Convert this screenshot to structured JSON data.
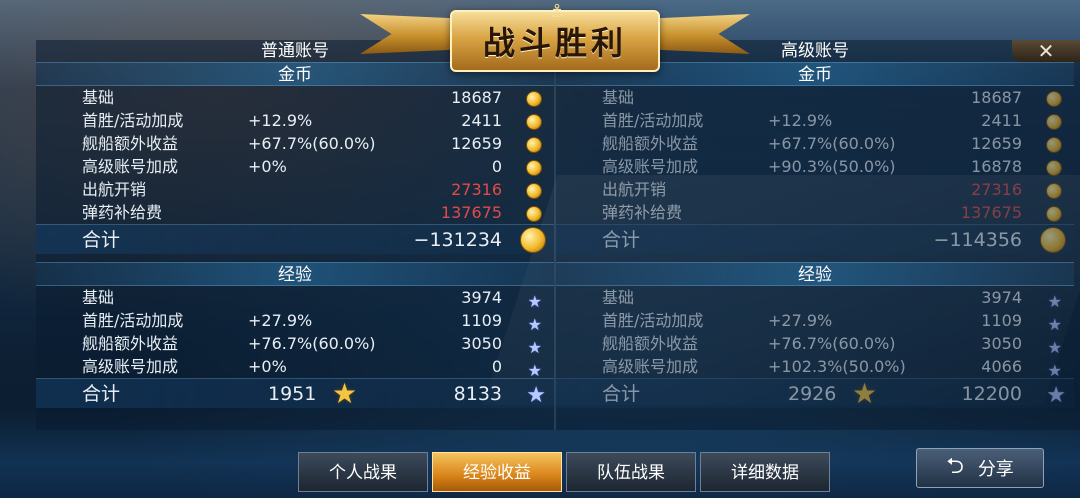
{
  "banner": {
    "title": "战斗胜利"
  },
  "close_label": "✕",
  "left": {
    "account_label": "普通账号",
    "gold": {
      "header": "金币",
      "rows": [
        {
          "label": "基础",
          "pct": "",
          "value": "18687",
          "red": false
        },
        {
          "label": "首胜/活动加成",
          "pct": "+12.9%",
          "value": "2411",
          "red": false
        },
        {
          "label": "舰船额外收益",
          "pct": "+67.7%(60.0%)",
          "value": "12659",
          "red": false
        },
        {
          "label": "高级账号加成",
          "pct": "+0%",
          "value": "0",
          "red": false
        },
        {
          "label": "出航开销",
          "pct": "",
          "value": "27316",
          "red": true
        },
        {
          "label": "弹药补给费",
          "pct": "",
          "value": "137675",
          "red": true
        }
      ],
      "total_label": "合计",
      "total_value": "−131234"
    },
    "exp": {
      "header": "经验",
      "rows": [
        {
          "label": "基础",
          "pct": "",
          "value": "3974"
        },
        {
          "label": "首胜/活动加成",
          "pct": "+27.9%",
          "value": "1109"
        },
        {
          "label": "舰船额外收益",
          "pct": "+76.7%(60.0%)",
          "value": "3050"
        },
        {
          "label": "高级账号加成",
          "pct": "+0%",
          "value": "0"
        }
      ],
      "total_label": "合计",
      "total_mid": "1951",
      "total_value": "8133"
    }
  },
  "right": {
    "account_label": "高级账号",
    "gold": {
      "header": "金币",
      "rows": [
        {
          "label": "基础",
          "pct": "",
          "value": "18687",
          "red": false
        },
        {
          "label": "首胜/活动加成",
          "pct": "+12.9%",
          "value": "2411",
          "red": false
        },
        {
          "label": "舰船额外收益",
          "pct": "+67.7%(60.0%)",
          "value": "12659",
          "red": false
        },
        {
          "label": "高级账号加成",
          "pct": "+90.3%(50.0%)",
          "value": "16878",
          "red": false
        },
        {
          "label": "出航开销",
          "pct": "",
          "value": "27316",
          "red": true
        },
        {
          "label": "弹药补给费",
          "pct": "",
          "value": "137675",
          "red": true
        }
      ],
      "total_label": "合计",
      "total_value": "−114356"
    },
    "exp": {
      "header": "经验",
      "rows": [
        {
          "label": "基础",
          "pct": "",
          "value": "3974"
        },
        {
          "label": "首胜/活动加成",
          "pct": "+27.9%",
          "value": "1109"
        },
        {
          "label": "舰船额外收益",
          "pct": "+76.7%(60.0%)",
          "value": "3050"
        },
        {
          "label": "高级账号加成",
          "pct": "+102.3%(50.0%)",
          "value": "4066"
        }
      ],
      "total_label": "合计",
      "total_mid": "2926",
      "total_value": "12200"
    }
  },
  "tabs": [
    {
      "label": "个人战果",
      "active": false
    },
    {
      "label": "经验收益",
      "active": true
    },
    {
      "label": "队伍战果",
      "active": false
    },
    {
      "label": "详细数据",
      "active": false
    }
  ],
  "share": {
    "label": "分享",
    "icon": "back-arrow-icon"
  },
  "colors": {
    "accent_gold": "#f2b92a",
    "negative": "#e04a4a",
    "active_tab": "#d8841a"
  }
}
